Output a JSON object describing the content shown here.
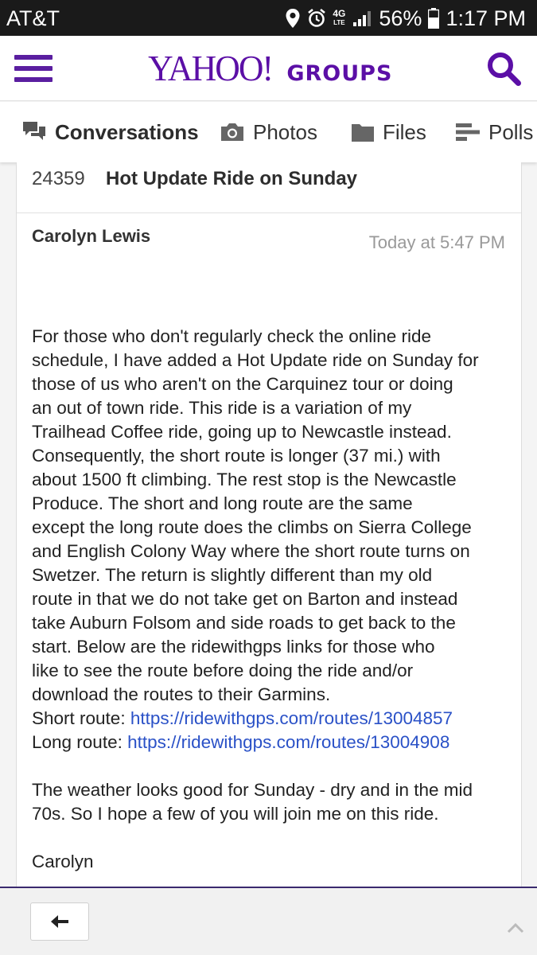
{
  "status_bar": {
    "carrier": "AT&T",
    "battery": "56%",
    "time": "1:17 PM",
    "network": "4G",
    "network_sub": "LTE",
    "icons": [
      "location-icon",
      "alarm-icon",
      "signal-icon",
      "battery-icon"
    ]
  },
  "header": {
    "logo_main": "YAHOO!",
    "logo_sub": "GROUPS",
    "brand_color": "#5b0fa6",
    "icons": [
      "menu-icon",
      "search-icon"
    ]
  },
  "tabs": [
    {
      "label": "Conversations",
      "icon": "conversations-icon",
      "active": true
    },
    {
      "label": "Photos",
      "icon": "camera-icon",
      "active": false
    },
    {
      "label": "Files",
      "icon": "folder-icon",
      "active": false
    },
    {
      "label": "Polls",
      "icon": "polls-icon",
      "active": false
    }
  ],
  "message": {
    "number": "24359",
    "subject": "Hot Update Ride on Sunday",
    "author": "Carolyn Lewis",
    "timestamp": "Today at 5:47 PM",
    "lines": [
      "For those who don't regularly check the online ride",
      "schedule, I have added a Hot Update ride on Sunday for",
      "those of us who aren't on the Carquinez tour or doing",
      "an out of town ride. This ride is a variation of my",
      "Trailhead Coffee ride, going up to Newcastle instead.",
      "Consequently, the short route is longer (37 mi.) with",
      "about 1500 ft climbing.  The rest stop is the Newcastle",
      "Produce.  The short and long route are the same",
      "except the long route does the climbs on Sierra College",
      "and English Colony Way where the short route turns on",
      "Swetzer.  The return is slightly different than my old",
      "route in that we do not take get on Barton and instead",
      "take Auburn Folsom and side roads to get back to the",
      "start.  Below are the ridewithgps links for those who",
      "like to see the route before doing the ride and/or",
      "download the routes to their Garmins."
    ],
    "short_route_label": "Short route: ",
    "short_route_url": "https://ridewithgps.com/routes/13004857",
    "long_route_label": "Long route: ",
    "long_route_url": "https://ridewithgps.com/routes/13004908",
    "closing_lines": [
      "The weather looks good for Sunday - dry and in the mid",
      "70s.  So I hope a few of you will join me on this ride."
    ],
    "signature": "Carolyn",
    "link_color": "#2a51c7"
  },
  "bottom_bar": {
    "icons": [
      "back-arrow-icon",
      "scroll-up-icon"
    ]
  }
}
